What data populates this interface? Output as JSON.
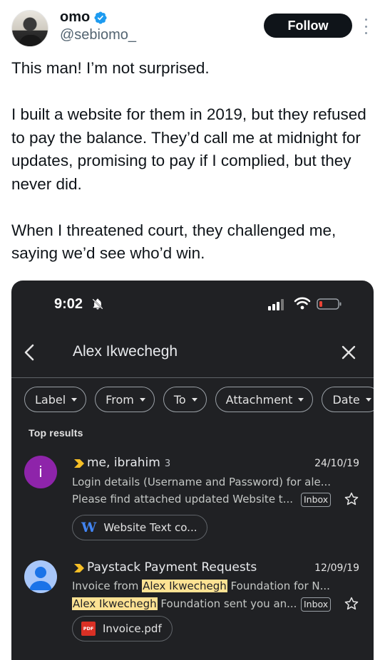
{
  "author": {
    "name": "omo",
    "handle": "@sebiomo_",
    "follow_label": "Follow"
  },
  "tweet": {
    "paragraph1": "This man! I’m not surprised.",
    "paragraph2": "I built a website for them in 2019, but they refused to pay the balance. They’d call me at midnight for updates, promising to pay if I complied, but they never did.",
    "paragraph3": "When I threatened court, they challenged me, saying we’d see who’d win."
  },
  "phone": {
    "status_time": "9:02",
    "search_query": "Alex Ikwechegh",
    "filters": [
      "Label",
      "From",
      "To",
      "Attachment",
      "Date"
    ],
    "section_label": "Top results",
    "emails": [
      {
        "avatar_letter": "i",
        "sender": "me, ibrahim",
        "count": "3",
        "date": "24/10/19",
        "line1": "Login details (Username and Password) for ale...",
        "line2": "Please find attached updated Website t...",
        "badge": "Inbox",
        "attachment": "Website Text co...",
        "attachment_icon": "W"
      },
      {
        "sender": "Paystack Payment Requests",
        "date": "12/09/19",
        "line1_pre": "Invoice from ",
        "line1_hl": "Alex Ikwechegh",
        "line1_post": " Foundation for N...",
        "line2_hl": "Alex Ikwechegh",
        "line2_post": " Foundation sent you an...",
        "badge": "Inbox",
        "attachment": "Invoice.pdf",
        "attachment_icon": "PDF"
      }
    ]
  },
  "colors": {
    "follow_bg": "#0f1419",
    "verified": "#1d9bf0",
    "gmail_bg": "#202124",
    "highlight": "#fde293",
    "importance": "#f6bf26",
    "avatar_purple": "#8e24aa",
    "battery_low": "#ea4335"
  }
}
